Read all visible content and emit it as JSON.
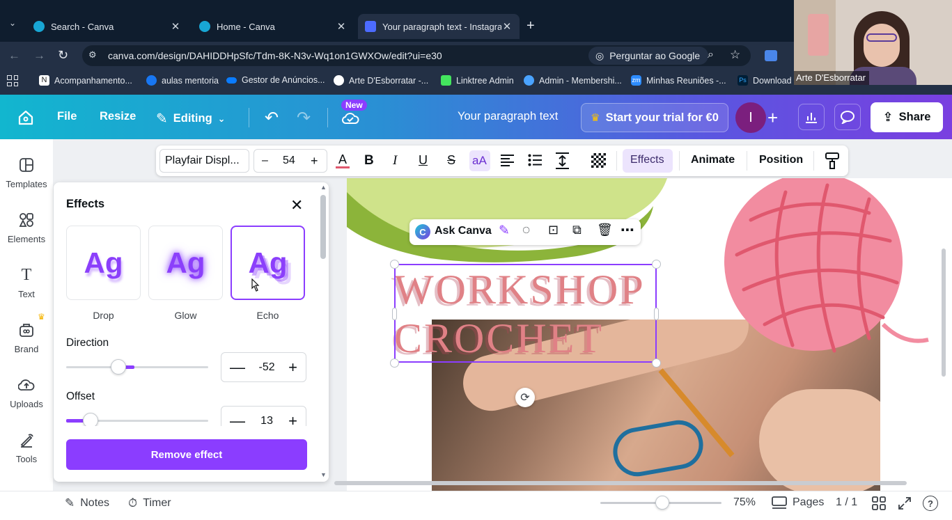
{
  "browser": {
    "tabs": [
      {
        "title": "Search - Canva",
        "active": false
      },
      {
        "title": "Home - Canva",
        "active": false
      },
      {
        "title": "Your paragraph text - Instagram",
        "active": true
      }
    ],
    "new_tab": "+",
    "url": "canva.com/design/DAHIDDHpSfc/Tdm-8K-N3v-Wq1on1GWXOw/edit?ui=e30",
    "ask_google": "Perguntar ao Google",
    "bookmarks": [
      "Acompanhamento...",
      "aulas mentoria",
      "Gestor de Anúncios...",
      "Arte D'Esborratar -...",
      "Linktree Admin",
      "Admin - Membershi...",
      "Minhas Reuniões -...",
      "Download"
    ]
  },
  "webcam": {
    "name": "Arte D'Esborratar"
  },
  "header": {
    "file": "File",
    "resize": "Resize",
    "editing": "Editing",
    "new_badge": "New",
    "doc_title": "Your paragraph text",
    "trial": "Start your trial for €0",
    "avatar_letter": "I",
    "share": "Share"
  },
  "rail": [
    {
      "label": "Templates",
      "icon": "templates-icon"
    },
    {
      "label": "Elements",
      "icon": "elements-icon"
    },
    {
      "label": "Text",
      "icon": "text-icon"
    },
    {
      "label": "Brand",
      "icon": "brand-icon"
    },
    {
      "label": "Uploads",
      "icon": "uploads-icon"
    },
    {
      "label": "Tools",
      "icon": "tools-icon"
    },
    {
      "label": "",
      "icon": "projects-icon"
    }
  ],
  "text_toolbar": {
    "font": "Playfair Displ...",
    "minus": "–",
    "size": "54",
    "plus": "+",
    "case": "aA",
    "effects": "Effects",
    "animate": "Animate",
    "position": "Position"
  },
  "effects_panel": {
    "title": "Effects",
    "preview_text": "Ag",
    "cards": [
      {
        "label": "Drop",
        "selected": false
      },
      {
        "label": "Glow",
        "selected": false
      },
      {
        "label": "Echo",
        "selected": true
      }
    ],
    "direction": {
      "label": "Direction",
      "value": "-52",
      "slider_fraction": 0.37
    },
    "offset": {
      "label": "Offset",
      "value": "13",
      "slider_fraction": 0.17
    },
    "remove_button": "Remove effect"
  },
  "ask_canva": "Ask Canva",
  "design": {
    "line1": "WORKSHOP",
    "line2": "CROCHET"
  },
  "bottom": {
    "notes": "Notes",
    "timer": "Timer",
    "zoom": "75%",
    "zoom_fraction": 0.51,
    "pages": "Pages",
    "page_count": "1 / 1"
  },
  "colors": {
    "accent": "#8b3dff",
    "headline": "#e08186",
    "header_gradient_start": "#12b6cf",
    "header_gradient_end": "#7a3fe0"
  }
}
